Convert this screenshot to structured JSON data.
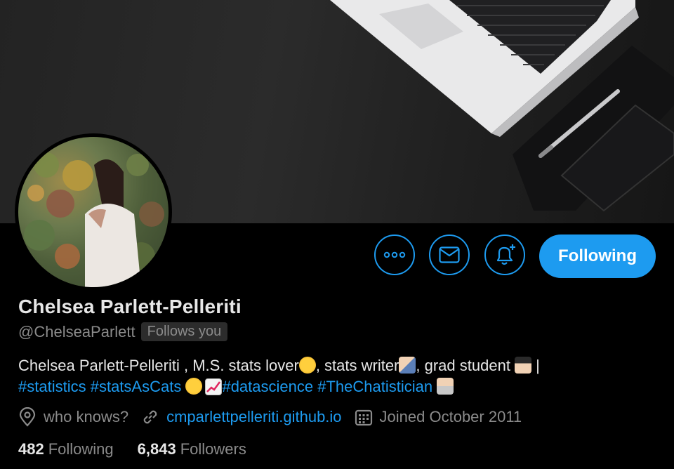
{
  "profile": {
    "name": "Chelsea Parlett-Pelleriti",
    "handle": "@ChelseaParlett",
    "follows_you": "Follows you",
    "bio": {
      "line1_text1": "Chelsea Parlett-Pelleriti , M.S. stats lover",
      "line1_text2": ", stats writer",
      "line1_text3": ", grad student ",
      "line1_text4": " |",
      "tag_statistics": "#statistics",
      "tag_statsascats": "#statsAsCats",
      "tag_datascience": "#datascience",
      "tag_chatistician": "#TheChatistician"
    },
    "location": "who knows?",
    "website": "cmparlettpelleriti.github.io",
    "joined": "Joined October 2011",
    "following_count": "482",
    "following_label": "Following",
    "followers_count": "6,843",
    "followers_label": "Followers"
  },
  "actions": {
    "more_icon": "more-icon",
    "message_icon": "envelope-icon",
    "notify_icon": "bell-plus-icon",
    "follow_label": "Following"
  },
  "colors": {
    "accent": "#1d9bf0",
    "background": "#000000",
    "muted_text": "#8b8b8b"
  }
}
